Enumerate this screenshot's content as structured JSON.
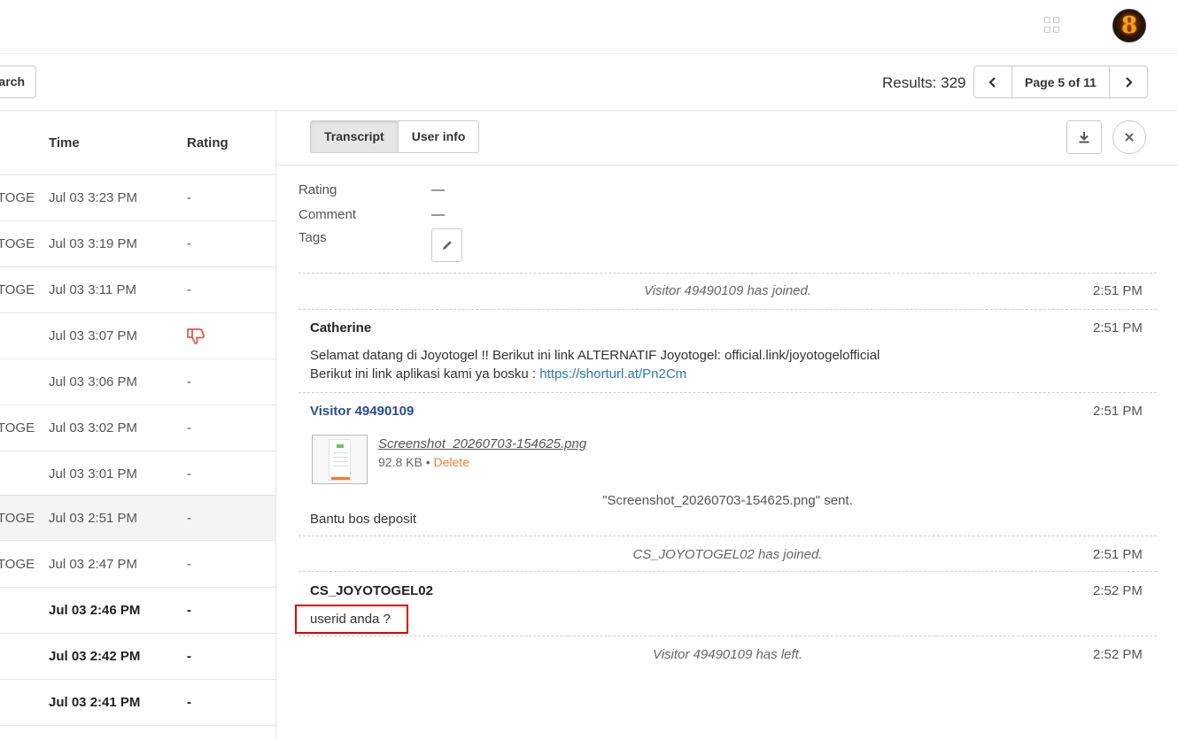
{
  "header": {
    "apps_icon": "grid-apps-icon",
    "avatar_glyph": "8"
  },
  "toolbar": {
    "search_label": "Search",
    "results_label": "Results: 329",
    "page_label": "Page 5 of 11"
  },
  "list": {
    "col_time": "Time",
    "col_rating": "Rating",
    "rows": [
      {
        "name": "JOYOTOGE...",
        "time": "Jul 03 3:23 PM",
        "rating": "-"
      },
      {
        "name": "JOYOTOGE...",
        "time": "Jul 03 3:19 PM",
        "rating": "-"
      },
      {
        "name": "JOYOTOGE...",
        "time": "Jul 03 3:11 PM",
        "rating": "-"
      },
      {
        "name": "",
        "time": "Jul 03 3:07 PM",
        "rating": "thumbs-down"
      },
      {
        "name": "",
        "time": "Jul 03 3:06 PM",
        "rating": "-"
      },
      {
        "name": "JOYOTOGE...",
        "time": "Jul 03 3:02 PM",
        "rating": "-"
      },
      {
        "name": "",
        "time": "Jul 03 3:01 PM",
        "rating": "-"
      },
      {
        "name": "JOYOTOGE...",
        "time": "Jul 03 2:51 PM",
        "rating": "-"
      },
      {
        "name": "JOYOTOGE...",
        "time": "Jul 03 2:47 PM",
        "rating": "-"
      },
      {
        "name": "",
        "time": "Jul 03 2:46 PM",
        "rating": "-"
      },
      {
        "name": "",
        "time": "Jul 03 2:42 PM",
        "rating": "-"
      },
      {
        "name": "",
        "time": "Jul 03 2:41 PM",
        "rating": "-"
      }
    ]
  },
  "detail": {
    "tab_transcript": "Transcript",
    "tab_userinfo": "User info",
    "rating_label": "Rating",
    "rating_value": "—",
    "comment_label": "Comment",
    "comment_value": "—",
    "tags_label": "Tags",
    "events": {
      "joined_visitor": {
        "text": "Visitor 49490109 has joined.",
        "time": "2:51 PM"
      },
      "catherine": {
        "sender": "Catherine",
        "time": "2:51 PM",
        "line1": "Selamat datang di Joyotogel !! Berikut ini link ALTERNATIF Joyotogel: official.link/joyotogelofficial",
        "line2_prefix": "Berikut ini link aplikasi kami ya bosku : ",
        "line2_link": "https://shorturl.at/Pn2Cm"
      },
      "visitor_msg": {
        "sender": "Visitor 49490109",
        "time": "2:51 PM",
        "file_name": "Screenshot_20260703-154625.png",
        "file_size": "92.8 KB",
        "file_delete": "Delete",
        "sent_note": "\"Screenshot_20260703-154625.png\" sent.",
        "text": "Bantu bos deposit"
      },
      "joined_cs": {
        "text": "CS_JOYOTOGEL02 has joined.",
        "time": "2:51 PM"
      },
      "cs_msg": {
        "sender": "CS_JOYOTOGEL02",
        "time": "2:52 PM",
        "text": "userid anda ?"
      },
      "left_visitor": {
        "text": "Visitor 49490109 has left.",
        "time": "2:52 PM"
      }
    }
  },
  "colors": {
    "accent_link": "#2a7ab8",
    "visitor_name": "#2a4d8f",
    "delete": "#e8823a",
    "thumbs_down": "#e05a4a",
    "highlight": "#e00000"
  }
}
